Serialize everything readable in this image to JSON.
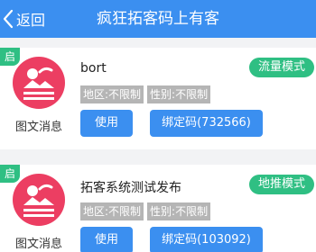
{
  "header": {
    "back_label": "返回",
    "title": "疯狂拓客码上有客"
  },
  "cards": [
    {
      "badge": "启",
      "thumb_caption": "图文消息",
      "name": "bort",
      "mode": "流量模式",
      "tags": [
        "地区:不限制",
        "性别:不限制"
      ],
      "use_label": "使用",
      "bind_label": "绑定码(732566)"
    },
    {
      "badge": "启",
      "thumb_caption": "图文消息",
      "name": "拓客系统测试发布",
      "mode": "地推模式",
      "tags": [
        "地区:不限制",
        "性别:不限制"
      ],
      "use_label": "使用",
      "bind_label": "绑定码(103092)"
    }
  ],
  "colors": {
    "primary": "#3b8ff0",
    "green": "#2fbf83",
    "thumb": "#ec3e62",
    "tag": "#b5b5b5"
  },
  "icons": {
    "back": "chevron-left-icon",
    "thumb": "news-article-icon"
  }
}
